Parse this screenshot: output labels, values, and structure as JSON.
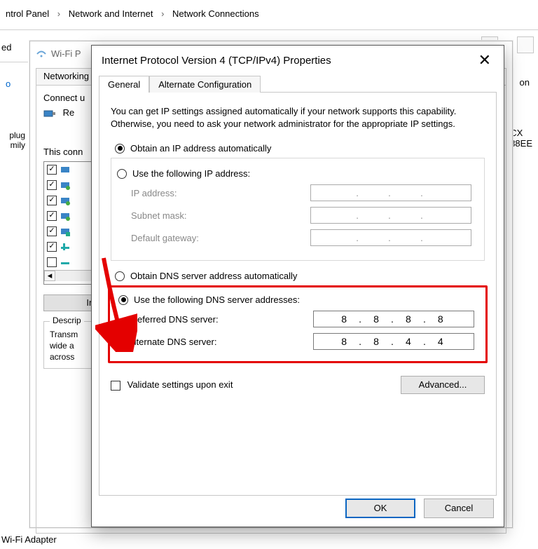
{
  "breadcrumb": {
    "seg1": "ntrol Panel",
    "seg2": "Network and Internet",
    "seg3": "Network Connections",
    "sep": "›"
  },
  "top_left_partial": "ed",
  "top_left_partial2": "o",
  "left_partial": {
    "l1": "plug",
    "l2": "mily"
  },
  "bg_right": {
    "l1": "on",
    "l2": "CX",
    "l3": "38EE"
  },
  "wifi_window": {
    "title": "Wi-Fi P",
    "tab_networking": "Networking",
    "connect_using": "Connect u",
    "realtek": "Re",
    "items_label": "This conn",
    "install": "Ins",
    "description_legend": "Descrip",
    "description_body": "Transm\nwide a\nacross"
  },
  "status_bottom": "Wi-Fi Adapter",
  "dialog": {
    "title": "Internet Protocol Version 4 (TCP/IPv4) Properties",
    "tabs": {
      "general": "General",
      "alt": "Alternate Configuration"
    },
    "intro": "You can get IP settings assigned automatically if your network supports this capability. Otherwise, you need to ask your network administrator for the appropriate IP settings.",
    "ip": {
      "auto": "Obtain an IP address automatically",
      "manual": "Use the following IP address:",
      "ip_address": "IP address:",
      "subnet": "Subnet mask:",
      "gateway": "Default gateway:"
    },
    "dns": {
      "auto": "Obtain DNS server address automatically",
      "manual": "Use the following DNS server addresses:",
      "preferred_label": "Preferred DNS server:",
      "alternate_label": "Alternate DNS server:",
      "preferred": [
        "8",
        "8",
        "8",
        "8"
      ],
      "alternate": [
        "8",
        "8",
        "4",
        "4"
      ]
    },
    "validate": "Validate settings upon exit",
    "advanced": "Advanced...",
    "ok": "OK",
    "cancel": "Cancel"
  }
}
